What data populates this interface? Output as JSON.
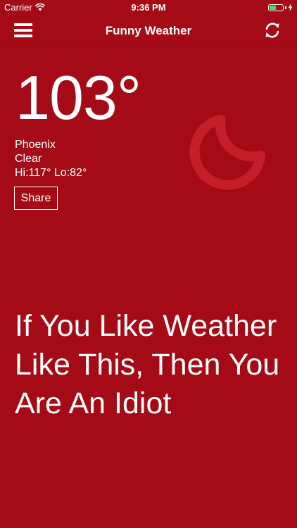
{
  "status_bar": {
    "carrier": "Carrier",
    "time": "9:36 PM",
    "battery_level": 0.5,
    "battery_color": "#4cd964",
    "icons": [
      "wifi-icon",
      "battery-icon",
      "charging-bolt-icon"
    ]
  },
  "nav": {
    "title": "Funny Weather",
    "menu_icon": "hamburger-menu-icon",
    "refresh_icon": "refresh-icon"
  },
  "weather": {
    "temperature": "103°",
    "city": "Phoenix",
    "condition": "Clear",
    "hi_lo": "Hi:117° Lo:82°",
    "condition_icon": "moon-icon"
  },
  "share_label": "Share",
  "tagline": "If You Like Weather Like This, Then You Are An Idiot",
  "colors": {
    "background": "#a50b16",
    "text": "#ffffff",
    "icon_tint": "#c41e2a"
  }
}
